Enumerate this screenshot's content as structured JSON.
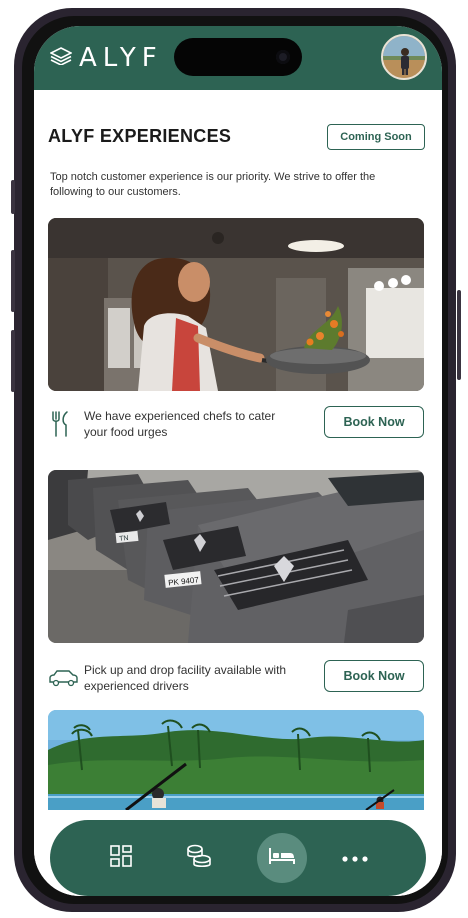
{
  "brand": {
    "logo_text": "ALYF"
  },
  "page": {
    "title": "ALYF EXPERIENCES",
    "coming_soon_label": "Coming Soon",
    "description": "Top notch customer experience is our priority. We strive to offer the following to our customers."
  },
  "experiences": [
    {
      "icon": "fork-knife-icon",
      "text": "We have experienced chefs to cater your food urges",
      "button": "Book Now"
    },
    {
      "icon": "car-icon",
      "text": "Pick up and drop facility available with experienced drivers",
      "button": "Book Now"
    }
  ],
  "car_plates": [
    "PK 9407",
    "TN"
  ],
  "navbar": {
    "items": [
      {
        "icon": "grid-icon",
        "active": false
      },
      {
        "icon": "coins-icon",
        "active": false
      },
      {
        "icon": "bed-icon",
        "active": true
      },
      {
        "icon": "more-icon",
        "active": false
      }
    ]
  },
  "colors": {
    "brand_green": "#2d6353",
    "active_nav": "#5a8c7e",
    "background": "#ffffff"
  }
}
